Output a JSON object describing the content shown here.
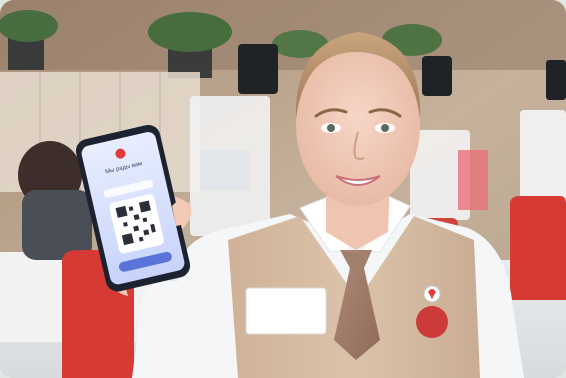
{
  "phone": {
    "screen_line1": "Мы рады вам",
    "screen_line2": "",
    "button_label": ""
  },
  "name_badge": {
    "brand": "",
    "name_line1": "",
    "name_line2": ""
  },
  "pin": {
    "label_top": "",
    "label_bottom": ""
  },
  "colors": {
    "background_wall": "#c8b6a1",
    "vest": "#d8bfa6",
    "shirt": "#f4f6f8",
    "chair_red": "#d53a34",
    "phone_screen": "#dfe6ff",
    "accent_red": "#e23b3b"
  }
}
